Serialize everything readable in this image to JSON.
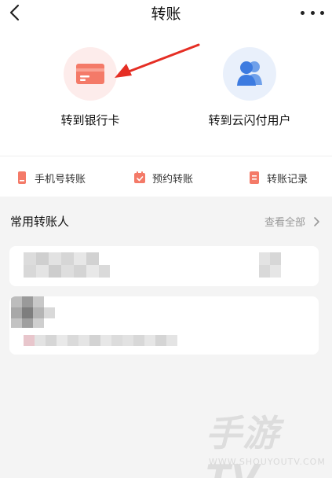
{
  "nav": {
    "title": "转账",
    "back_icon": "chevron-left-icon",
    "more_icon": "more-dots-icon"
  },
  "features": [
    {
      "label": "转到银行卡",
      "icon": "bank-card-icon",
      "circle_color": "#fdeceb",
      "icon_color": "#f47a68"
    },
    {
      "label": "转到云闪付用户",
      "icon": "users-icon",
      "circle_color": "#e9f0fb",
      "icon_color": "#3d7be0"
    }
  ],
  "shortcuts": [
    {
      "label": "手机号转账",
      "icon": "phone-icon"
    },
    {
      "label": "预约转账",
      "icon": "calendar-icon"
    },
    {
      "label": "转账记录",
      "icon": "document-icon"
    }
  ],
  "recent": {
    "title": "常用转账人",
    "view_all": "查看全部"
  },
  "watermark": {
    "text": "手游TV",
    "sub": "WWW.SHOUYOUTV.COM"
  },
  "colors": {
    "accent_red": "#f47a68",
    "accent_blue": "#3d7be0",
    "background": "#f4f4f4",
    "annotation_arrow": "#e52e24"
  }
}
